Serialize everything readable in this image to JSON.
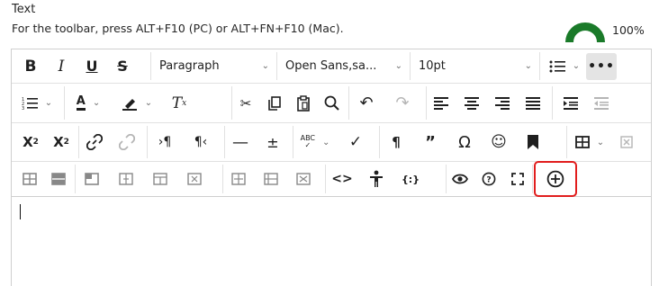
{
  "header": {
    "label": "Text",
    "hint": "For the toolbar, press ALT+F10 (PC) or ALT+FN+F10 (Mac).",
    "gauge_value": "100%"
  },
  "toolbar": {
    "row1": {
      "paragraph": "Paragraph",
      "font_family": "Open Sans,sa...",
      "font_size": "10pt"
    }
  },
  "colors": {
    "gauge": "#1a7a29",
    "highlight_border": "#e11d1d",
    "more_bg": "#e4e4e4"
  },
  "icons": [
    "bold-icon",
    "italic-icon",
    "underline-icon",
    "strikethrough-icon",
    "bullet-list-icon",
    "more-icon",
    "numbered-list-icon",
    "text-color-icon",
    "highlight-color-icon",
    "clear-formatting-icon",
    "cut-icon",
    "copy-icon",
    "paste-icon",
    "find-icon",
    "undo-icon",
    "redo-icon",
    "align-left-icon",
    "align-center-icon",
    "align-right-icon",
    "justify-icon",
    "indent-icon",
    "outdent-icon",
    "superscript-icon",
    "subscript-icon",
    "link-icon",
    "unlink-icon",
    "ltr-icon",
    "rtl-icon",
    "horizontal-rule-icon",
    "plus-minus-icon",
    "spellcheck-icon",
    "checkmark-icon",
    "pilcrow-icon",
    "quote-icon",
    "omega-icon",
    "emoji-icon",
    "bookmark-icon",
    "table-icon",
    "table-delete-icon",
    "table-insert-row-before-icon",
    "table-insert-row-after-icon",
    "table-delete-row-icon",
    "table-insert-col-before-icon",
    "table-insert-col-after-icon",
    "table-delete-col-icon",
    "table-merge-cells-icon",
    "table-split-cell-icon",
    "table-cell-props-icon",
    "source-code-icon",
    "accessibility-icon",
    "math-icon",
    "preview-icon",
    "help-icon",
    "fullscreen-icon",
    "add-content-icon"
  ]
}
